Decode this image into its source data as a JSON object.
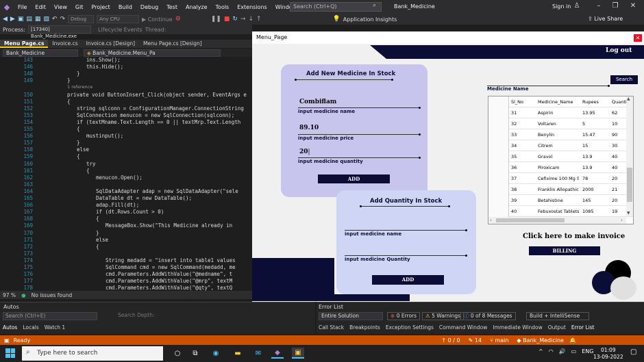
{
  "vs": {
    "menu": [
      "File",
      "Edit",
      "View",
      "Git",
      "Project",
      "Build",
      "Debug",
      "Test",
      "Analyze",
      "Tools",
      "Extensions",
      "Window",
      "Help"
    ],
    "search_placeholder": "Search (Ctrl+Q)",
    "solution_title": "Bank_Medicine",
    "sign_in": "Sign in",
    "live_share": "Live Share",
    "toolbar": {
      "config": "Debug",
      "platform": "Any CPU",
      "continue": "Continue",
      "app_insights": "Application Insights",
      "stack_frame": "Stack Frame:"
    },
    "process_label": "Process:",
    "process_value": "[17340] Bank_Medicine.exe",
    "lifecycle": "Lifecycle Events",
    "thread": "Thread:",
    "doc_tabs": [
      "Menu Page.cs",
      "Invoice.cs",
      "Invoice.cs [Design]",
      "Menu Page.cs [Design]"
    ],
    "nav_project": "Bank_Medicine",
    "nav_class": "Bank_Medicine.Menu_Pa",
    "code_lines": [
      {
        "n": "143",
        "t": "ins.Show();"
      },
      {
        "n": "146",
        "t": "this.Hide();"
      },
      {
        "n": "148",
        "t": "}"
      },
      {
        "n": "149",
        "t": "}"
      },
      {
        "n": "",
        "t": "1 reference"
      },
      {
        "n": "150",
        "t": "private void ButtonInsert_Click(object sender, EventArgs e"
      },
      {
        "n": "151",
        "t": "{"
      },
      {
        "n": "152",
        "t": "string sqlconn = ConfigurationManager.ConnectionString"
      },
      {
        "n": "153",
        "t": "SqlConnection menucon = new SqlConnection(sqlconn);"
      },
      {
        "n": "154",
        "t": "if (textMname.Text.Length == 0 || textMrp.Text.Length"
      },
      {
        "n": "155",
        "t": "{"
      },
      {
        "n": "156",
        "t": "mustinput();"
      },
      {
        "n": "157",
        "t": "}"
      },
      {
        "n": "158",
        "t": "else"
      },
      {
        "n": "159",
        "t": "{"
      },
      {
        "n": "160",
        "t": "try"
      },
      {
        "n": "161",
        "t": "{"
      },
      {
        "n": "162",
        "t": "menucon.Open();"
      },
      {
        "n": "163",
        "t": ""
      },
      {
        "n": "164",
        "t": "SqlDataAdapter adap = new SqlDataAdapter(\"sele"
      },
      {
        "n": "165",
        "t": "DataTable dt = new DataTable();"
      },
      {
        "n": "166",
        "t": "adap.Fill(dt);"
      },
      {
        "n": "167",
        "t": "if (dt.Rows.Count > 0)"
      },
      {
        "n": "168",
        "t": "{"
      },
      {
        "n": "169",
        "t": "MessageBox.Show(\"This Medicine already in"
      },
      {
        "n": "170",
        "t": "}"
      },
      {
        "n": "171",
        "t": "else"
      },
      {
        "n": "172",
        "t": "{"
      },
      {
        "n": "173",
        "t": ""
      },
      {
        "n": "174",
        "t": "String medadd = \"insert into table1 values"
      },
      {
        "n": "175",
        "t": "SqlCommand cmd = new SqlCommand(medadd, me"
      },
      {
        "n": "176",
        "t": "cmd.Parameters.AddWithValue(\"@medname\", t"
      },
      {
        "n": "177",
        "t": "cmd.Parameters.AddWithValue(\"@mrp\", textM"
      },
      {
        "n": "178",
        "t": "cmd.Parameters.AddWithValue(\"@qty\", textQ"
      }
    ],
    "zoom": "97 %",
    "issues": "No issues found",
    "autos_title": "Autos",
    "autos_search": "Search (Ctrl+E)",
    "search_depth": "Search Depth:",
    "autos_tabs": [
      "Autos",
      "Locals",
      "Watch 1"
    ],
    "errlist_title": "Error List",
    "errlist_scope": "Entire Solution",
    "errors": "0 Errors",
    "warnings": "5 Warnings",
    "messages": "0 of 8 Messages",
    "build_filter": "Build + IntelliSense",
    "bottom_tabs": [
      "Call Stack",
      "Breakpoints",
      "Exception Settings",
      "Command Window",
      "Immediate Window",
      "Output",
      "Error List"
    ],
    "status_ready": "Ready",
    "status_lines": "0 / 0",
    "status_commits": "14",
    "status_branch": "main",
    "status_repo": "Bank_Medicine"
  },
  "taskbar": {
    "search_placeholder": "Type here to search",
    "lang": "ENG",
    "time": "01:09",
    "date": "13-09-2022"
  },
  "form": {
    "title": "Menu_Page",
    "logout": "Log out",
    "add_medicine": {
      "title": "Add New Medicine In Stock",
      "name_value": "Combiflam",
      "name_label": "input medicine name",
      "price_value": "89.10",
      "price_label": "input medicine price",
      "qty_value": "20",
      "qty_label": "input medicine quantity",
      "button": "ADD"
    },
    "add_quantity": {
      "title": "Add Quantity In Stock",
      "name_label": "input medicine name",
      "qty_label": "input medicine Quantity",
      "button": "ADD"
    },
    "search_button": "Search",
    "search_label": "Medicine Name",
    "grid": {
      "columns": [
        "Sl_No",
        "Medicine_Name",
        "Rupees",
        "Quantit"
      ],
      "rows": [
        [
          "31",
          "Aspirin",
          "13.95",
          "62"
        ],
        [
          "32",
          "Voltaren",
          "5",
          "10"
        ],
        [
          "33",
          "Benylin",
          "15.47",
          "90"
        ],
        [
          "34",
          "Citrem",
          "15",
          "30"
        ],
        [
          "35",
          "Gravol",
          "13.9",
          "40"
        ],
        [
          "36",
          "Piroxicam",
          "13.9",
          "40"
        ],
        [
          "37",
          "Cefixime 100 Mg S...",
          "78",
          "20"
        ],
        [
          "38",
          "Franklin Allopathic",
          "2000",
          "21"
        ],
        [
          "39",
          "Betahistine",
          "145",
          "20"
        ],
        [
          "40",
          "Febuxostat Tablets ...",
          "1085",
          "19"
        ]
      ],
      "new_row_marker": "*"
    },
    "invoice_prompt": "Click here to make invoice",
    "billing_button": "BILLING"
  }
}
